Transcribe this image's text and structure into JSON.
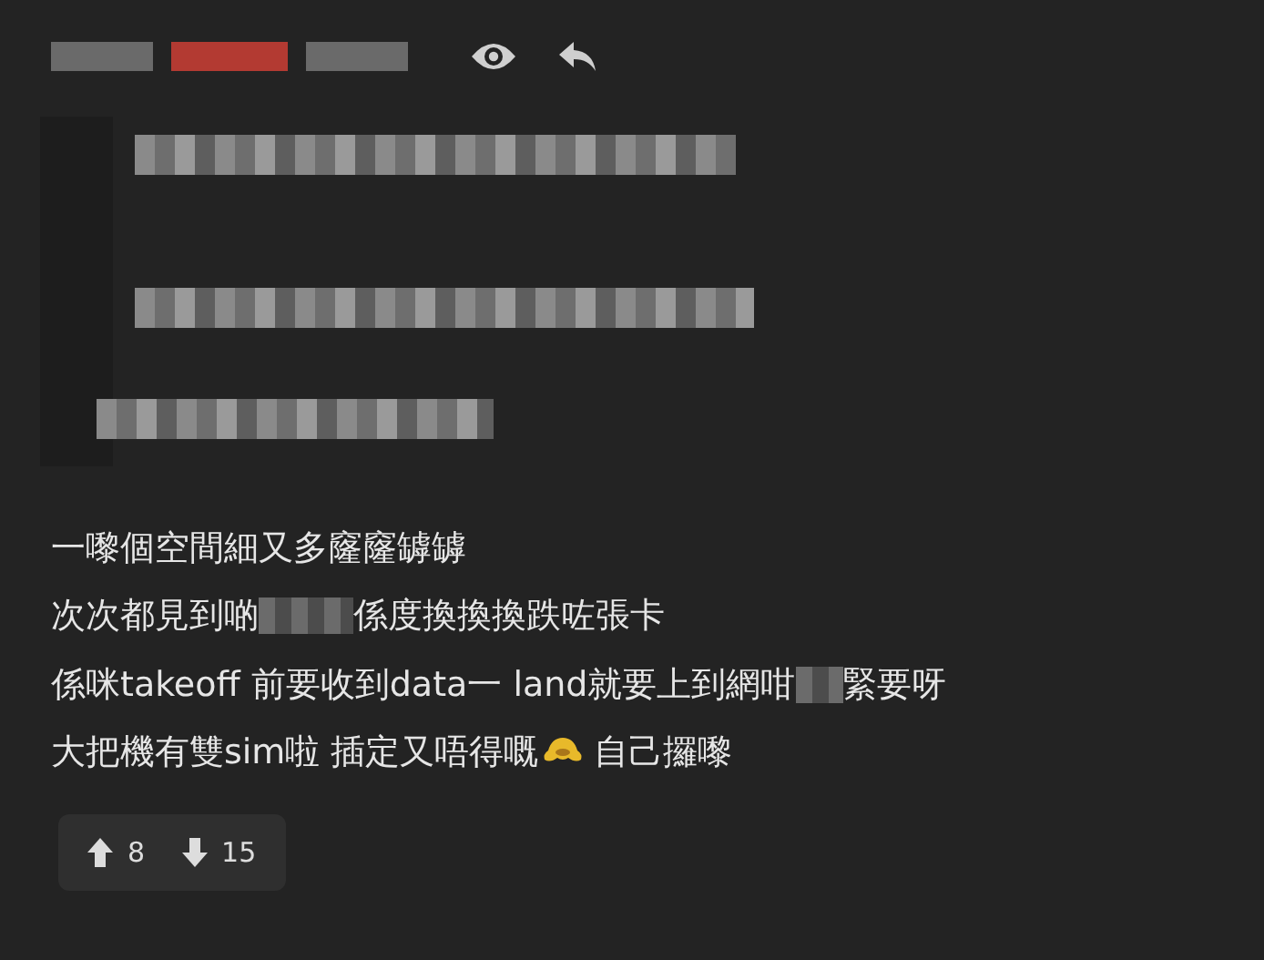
{
  "header": {
    "user_parts": [
      {
        "kind": "redacted",
        "color": "#6a6a6a"
      },
      {
        "kind": "redacted",
        "color": "#b33a32"
      },
      {
        "kind": "redacted",
        "color": "#6a6a6a"
      }
    ]
  },
  "quote": {
    "lines": [
      {
        "kind": "redacted"
      },
      {
        "kind": "redacted"
      },
      {
        "kind": "redacted"
      }
    ]
  },
  "body": {
    "lines": [
      [
        {
          "kind": "text",
          "text": "一嚟個空間細又多窿窿罅罅"
        }
      ],
      [
        {
          "kind": "text",
          "text": "次次都見到啲"
        },
        {
          "kind": "redacted"
        },
        {
          "kind": "text",
          "text": "係度換換換跌咗張卡"
        }
      ],
      [
        {
          "kind": "text",
          "text": "係咪takeoff 前要收到data一 land就要上到網咁"
        },
        {
          "kind": "redacted"
        },
        {
          "kind": "text",
          "text": "緊要呀"
        }
      ],
      [
        {
          "kind": "text",
          "text": "大把機有雙sim啦 插定又唔得嘅"
        },
        {
          "kind": "emoji"
        },
        {
          "kind": "text",
          "text": " 自己攞嚟"
        }
      ]
    ]
  },
  "votes": {
    "up": "8",
    "down": "15"
  }
}
